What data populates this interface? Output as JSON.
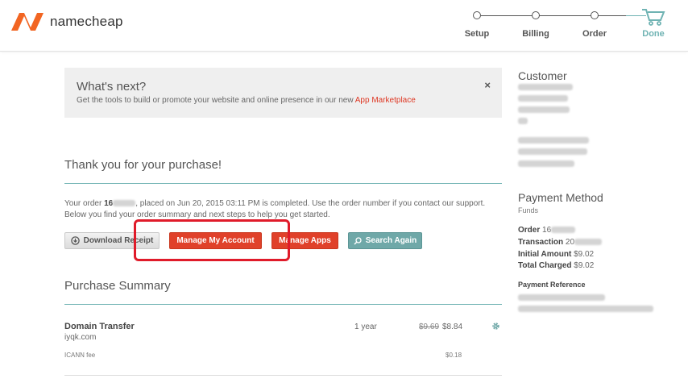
{
  "header": {
    "brand": "namecheap",
    "steps": [
      {
        "label": "Setup",
        "state": "complete"
      },
      {
        "label": "Billing",
        "state": "complete"
      },
      {
        "label": "Order",
        "state": "complete"
      },
      {
        "label": "Done",
        "state": "current"
      }
    ]
  },
  "whats_next": {
    "title": "What's next?",
    "text": "Get the tools to build or promote your website and online presence in our new ",
    "link": "App Marketplace",
    "close": "×"
  },
  "thanks": {
    "title": "Thank you for your purchase!",
    "order_prefix": "Your order ",
    "order_number_visible": "16",
    "order_middle": ", placed on Jun 20, 2015 03:11 PM is completed. Use the order number if you contact our support.",
    "order_line2": "Below you find your order summary and next steps to help you get started."
  },
  "buttons": {
    "download_receipt": "Download Receipt",
    "manage_account": "Manage My Account",
    "manage_apps": "Manage Apps",
    "search_again": "Search Again"
  },
  "summary": {
    "title": "Purchase Summary",
    "item": {
      "name": "Domain Transfer",
      "domain": "iyqk.com",
      "period": "1 year",
      "old_price": "$9.69",
      "price": "$8.84"
    },
    "fee": {
      "name": "ICANN fee",
      "price": "$0.18"
    }
  },
  "customer": {
    "title": "Customer"
  },
  "payment": {
    "title": "Payment Method",
    "method": "Funds",
    "order_label": "Order",
    "order_value": "16",
    "transaction_label": "Transaction",
    "transaction_value": "20",
    "initial_label": "Initial Amount",
    "initial_value": "$9.02",
    "charged_label": "Total Charged",
    "charged_value": "$9.02",
    "reference_label": "Payment Reference"
  },
  "colors": {
    "accent_red": "#e0412a",
    "accent_teal": "#6fa8a8",
    "highlight": "#e01b2a",
    "brand_orange": "#f26522"
  }
}
